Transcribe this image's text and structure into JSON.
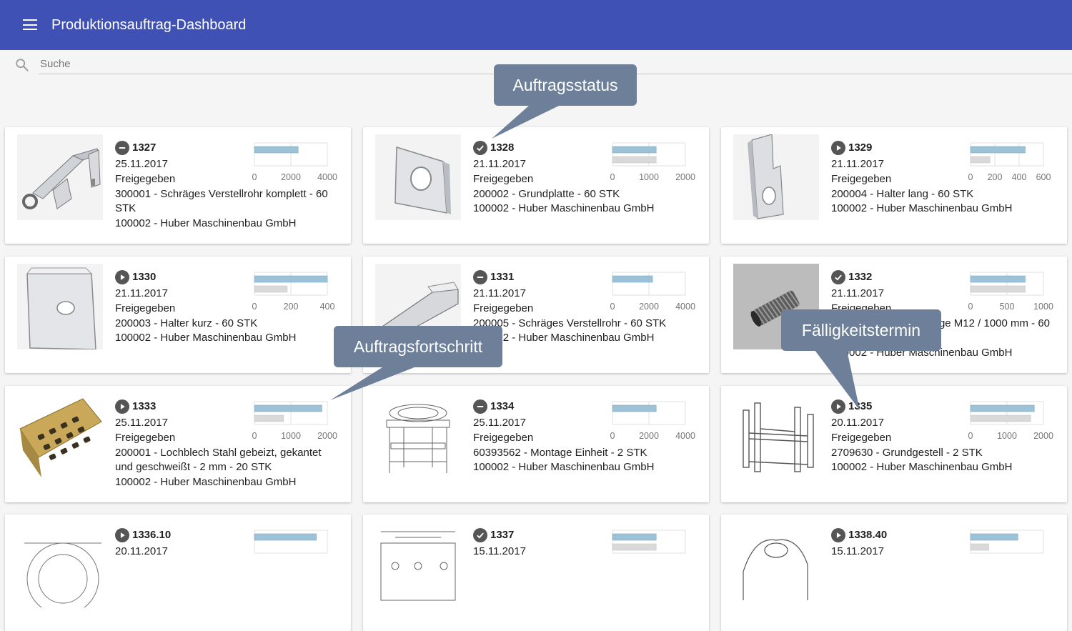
{
  "app": {
    "title": "Produktionsauftrag-Dashboard"
  },
  "search": {
    "placeholder": "Suche",
    "value": ""
  },
  "colors": {
    "appbar": "#3f51b5",
    "bar_done": "#9bc2d6",
    "bar_target": "#d9d9d9",
    "callout": "#6d7f99"
  },
  "orders": [
    {
      "number": "1327",
      "status_icon": "minus-circle-icon",
      "date": "25.11.2017",
      "status": "Freigegeben",
      "article": "300001 - Schräges Verstellrohr komplett - 60 STK",
      "customer": "100002 - Huber Maschinenbau GmbH",
      "image": "rohr-mit-oese",
      "progress": {
        "ticks": [
          "0",
          "2000",
          "4000"
        ],
        "max": 4000,
        "done": 2400,
        "target": null
      }
    },
    {
      "number": "1328",
      "status_icon": "check-circle-icon",
      "date": "21.11.2017",
      "status": "Freigegeben",
      "article": "200002 - Grundplatte - 60 STK",
      "customer": "100002 - Huber Maschinenbau GmbH",
      "image": "grundplatte",
      "progress": {
        "ticks": [
          "0",
          "1000",
          "2000"
        ],
        "max": 2000,
        "done": 1200,
        "target": 1200
      }
    },
    {
      "number": "1329",
      "status_icon": "play-circle-icon",
      "date": "21.11.2017",
      "status": "Freigegeben",
      "article": "200004 - Halter lang - 60 STK",
      "customer": "100002 - Huber Maschinenbau GmbH",
      "image": "halter-lang",
      "progress": {
        "ticks": [
          "0",
          "200",
          "400",
          "600"
        ],
        "max": 600,
        "done": 450,
        "target": 160
      }
    },
    {
      "number": "1330",
      "status_icon": "play-circle-icon",
      "date": "21.11.2017",
      "status": "Freigegeben",
      "article": "200003 - Halter kurz - 60 STK",
      "customer": "100002 - Huber Maschinenbau GmbH",
      "image": "halter-kurz",
      "progress": {
        "ticks": [
          "0",
          "200",
          "400"
        ],
        "max": 400,
        "done": 400,
        "target": 180
      }
    },
    {
      "number": "1331",
      "status_icon": "minus-circle-icon",
      "date": "21.11.2017",
      "status": "Freigegeben",
      "article": "200005 - Schräges Verstellrohr - 60 STK",
      "customer": "100002 - Huber Maschinenbau GmbH",
      "image": "verstellrohr",
      "progress": {
        "ticks": [
          "0",
          "2000",
          "4000"
        ],
        "max": 4000,
        "done": 2200,
        "target": null
      }
    },
    {
      "number": "1332",
      "status_icon": "check-circle-icon",
      "date": "21.11.2017",
      "status": "Freigegeben",
      "article": "200026 - Gewindestange M12 / 1000 mm - 60 STK",
      "customer": "100002 - Huber Maschinenbau GmbH",
      "image": "gewindestange",
      "progress": {
        "ticks": [
          "0",
          "500",
          "1000"
        ],
        "max": 1000,
        "done": 750,
        "target": 750
      }
    },
    {
      "number": "1333",
      "status_icon": "play-circle-icon",
      "date": "25.11.2017",
      "status": "Freigegeben",
      "article": "200001 - Lochblech Stahl gebeizt, gekantet und geschweißt - 2 mm - 20 STK",
      "customer": "100002 - Huber Maschinenbau GmbH",
      "image": "lochblech",
      "progress": {
        "ticks": [
          "0",
          "1000",
          "2000"
        ],
        "max": 2000,
        "done": 1850,
        "target": 800
      }
    },
    {
      "number": "1334",
      "status_icon": "minus-circle-icon",
      "date": "25.11.2017",
      "status": "Freigegeben",
      "article": "60393562 - Montage Einheit - 2 STK",
      "customer": "100002 - Huber Maschinenbau GmbH",
      "image": "montage-einheit",
      "progress": {
        "ticks": [
          "0",
          "2000",
          "4000"
        ],
        "max": 4000,
        "done": 2400,
        "target": null
      }
    },
    {
      "number": "1335",
      "status_icon": "play-circle-icon",
      "date": "20.11.2017",
      "status": "Freigegeben",
      "article": "2709630 - Grundgestell - 2 STK",
      "customer": "100002 - Huber Maschinenbau GmbH",
      "image": "grundgestell",
      "progress": {
        "ticks": [
          "0",
          "1000",
          "2000"
        ],
        "max": 2000,
        "done": 1750,
        "target": 1650
      }
    },
    {
      "number": "1336.10",
      "status_icon": "play-circle-icon",
      "date": "20.11.2017",
      "status": "",
      "article": "",
      "customer": "",
      "image": "zeichnung-rund",
      "progress": {
        "ticks": [],
        "max": 100,
        "done": 85,
        "target": null
      }
    },
    {
      "number": "1337",
      "status_icon": "check-circle-icon",
      "date": "15.11.2017",
      "status": "",
      "article": "",
      "customer": "",
      "image": "zeichnung-platte",
      "progress": {
        "ticks": [],
        "max": 100,
        "done": 60,
        "target": 60
      }
    },
    {
      "number": "1338.40",
      "status_icon": "play-circle-icon",
      "date": "15.11.2017",
      "status": "",
      "article": "",
      "customer": "",
      "image": "gussteil",
      "progress": {
        "ticks": [],
        "max": 100,
        "done": 65,
        "target": 25
      }
    }
  ],
  "callouts": {
    "auftragsstatus": "Auftragsstatus",
    "auftragsfortschritt": "Auftragsfortschritt",
    "faelligkeitstermin": "Fälligkeitstermin"
  }
}
